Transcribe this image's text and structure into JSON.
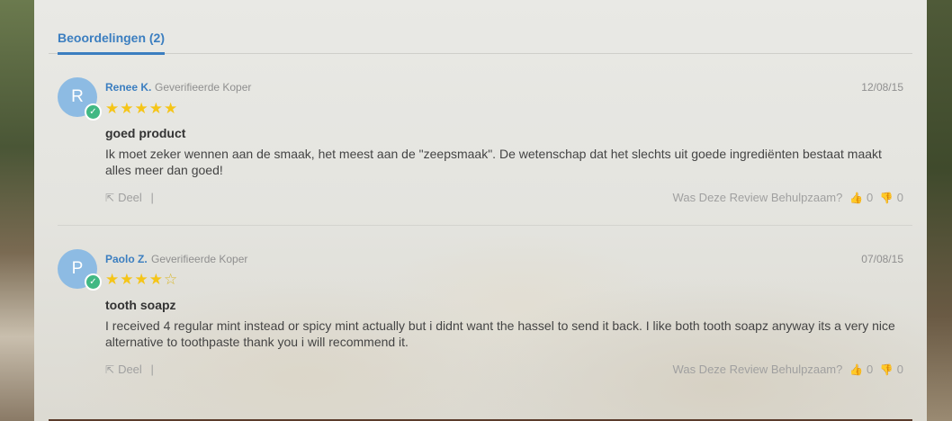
{
  "tab": {
    "label": "Beoordelingen (2)"
  },
  "reviews": [
    {
      "avatar_letter": "R",
      "name": "Renee K.",
      "verified_label": "Geverifieerde Koper",
      "date": "12/08/15",
      "rating": 5,
      "stars": "★★★★★",
      "title": "goed product",
      "body": "Ik moet zeker wennen aan de smaak, het meest aan de \"zeepsmaak\". De wetenschap dat het slechts uit goede ingrediënten bestaat maakt alles meer dan goed!",
      "share_label": "Deel",
      "helpful_label": "Was Deze Review Behulpzaam?",
      "up_count": "0",
      "down_count": "0"
    },
    {
      "avatar_letter": "P",
      "name": "Paolo Z.",
      "verified_label": "Geverifieerde Koper",
      "date": "07/08/15",
      "rating": 4,
      "stars": "★★★★☆",
      "title": "tooth soapz",
      "body": "I received 4 regular mint instead or spicy mint actually but i didnt want the hassel to send it back. I like both tooth soapz anyway its a very nice alternative to toothpaste thank you i will recommend it.",
      "share_label": "Deel",
      "helpful_label": "Was Deze Review Behulpzaam?",
      "up_count": "0",
      "down_count": "0"
    }
  ],
  "colors": {
    "accent": "#3b7ec0",
    "star": "#f5c518",
    "verified": "#41b883"
  }
}
